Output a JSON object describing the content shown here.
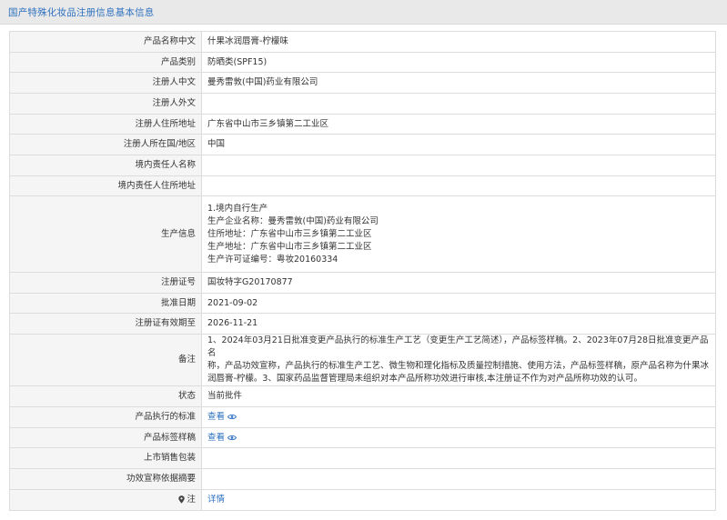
{
  "header": {
    "title": "国产特殊化妆品注册信息基本信息"
  },
  "rows": {
    "product_name_cn": {
      "label": "产品名称中文",
      "value": "什果冰润唇膏-柠檬味"
    },
    "product_category": {
      "label": "产品类别",
      "value": "防晒类(SPF15)"
    },
    "registrant_cn": {
      "label": "注册人中文",
      "value": "曼秀雷敦(中国)药业有限公司"
    },
    "registrant_en": {
      "label": "注册人外文",
      "value": ""
    },
    "registrant_address": {
      "label": "注册人住所地址",
      "value": "广东省中山市三乡镇第二工业区"
    },
    "registrant_country": {
      "label": "注册人所在国/地区",
      "value": "中国"
    },
    "domestic_agent_name": {
      "label": "境内责任人名称",
      "value": ""
    },
    "domestic_agent_address": {
      "label": "境内责任人住所地址",
      "value": ""
    },
    "production_info": {
      "label": "生产信息",
      "lines": [
        "1.境内自行生产",
        "生产企业名称：曼秀雷敦(中国)药业有限公司",
        "住所地址：广东省中山市三乡镇第二工业区",
        "生产地址：广东省中山市三乡镇第二工业区",
        "生产许可证编号：粤妆20160334"
      ]
    },
    "registration_no": {
      "label": "注册证号",
      "value": "国妆特字G20170877"
    },
    "approval_date": {
      "label": "批准日期",
      "value": "2021-09-02"
    },
    "valid_until": {
      "label": "注册证有效期至",
      "value": "2026-11-21"
    },
    "remarks": {
      "label": "备注",
      "lines": [
        "1、2024年03月21日批准变更产品执行的标准生产工艺（变更生产工艺简述），产品标签样稿。2、2023年07月28日批准变更产品名",
        "称，产品功效宣称，产品执行的标准生产工艺、微生物和理化指标及质量控制措施、使用方法，产品标签样稿，原产品名称为什果冰",
        "润唇膏-柠檬。3、国家药品监督管理局未组织对本产品所称功效进行审核,本注册证不作为对产品所称功效的认可。"
      ]
    },
    "status": {
      "label": "状态",
      "value": "当前批件"
    },
    "product_standard": {
      "label": "产品执行的标准",
      "link": "查看"
    },
    "product_label": {
      "label": "产品标签样稿",
      "link": "查看"
    },
    "packaging": {
      "label": "上市销售包装",
      "value": ""
    },
    "efficacy_basis": {
      "label": "功效宣称依据摘要",
      "value": ""
    },
    "note": {
      "label": "注",
      "link": "详情"
    }
  },
  "icons": {
    "eye": "eye-icon",
    "pin": "location-pin-icon"
  },
  "colors": {
    "link": "#2a6fc2",
    "title": "#2f72c0",
    "label_bg": "#f5f5f5",
    "border": "#dcdcdc"
  }
}
